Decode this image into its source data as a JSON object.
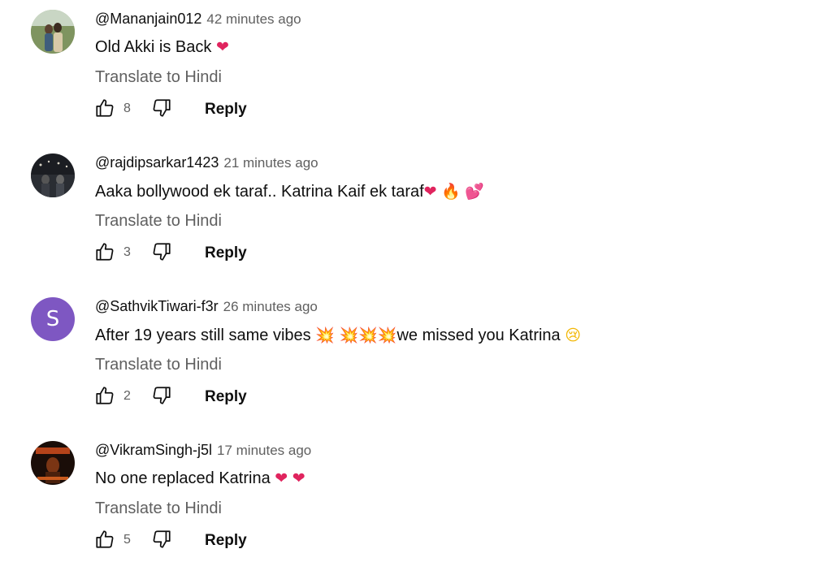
{
  "comments": [
    {
      "author": "@Mananjain012",
      "time": "42 minutes ago",
      "text": "Old Akki is Back",
      "emojis": [
        "❤"
      ],
      "translate": "Translate to Hindi",
      "likes": "8",
      "reply": "Reply",
      "avatar": "photo-two-people-outdoors"
    },
    {
      "author": "@rajdipsarkar1423",
      "time": "21 minutes ago",
      "text": "Aaka bollywood ek taraf.. Katrina Kaif ek taraf",
      "emojis": [
        "❤",
        "🔥",
        "💕"
      ],
      "translate": "Translate to Hindi",
      "likes": "3",
      "reply": "Reply",
      "avatar": "photo-dark-crowd-lights"
    },
    {
      "author": "@SathvikTiwari-f3r",
      "time": "26 minutes ago",
      "text_before": "After 19 years still same vibes",
      "text_after": "we missed you Katrina",
      "emojis_mid": [
        "💥",
        "💥",
        "💥",
        "💥"
      ],
      "emojis_end": [
        "😢"
      ],
      "translate": "Translate to Hindi",
      "likes": "2",
      "reply": "Reply",
      "avatar_letter": "S",
      "avatar_color": "#7e57c2"
    },
    {
      "author": "@VikramSingh-j5l",
      "time": "17 minutes ago",
      "text": "No one replaced Katrina",
      "emojis": [
        "❤",
        "❤"
      ],
      "translate": "Translate to Hindi",
      "likes": "5",
      "reply": "Reply",
      "avatar": "photo-dark-poster-orange"
    }
  ],
  "icons": {
    "like": "thumbs-up-icon",
    "dislike": "thumbs-down-icon"
  },
  "colors": {
    "primary_text": "#0f0f0f",
    "secondary_text": "#606060",
    "avatar_purple": "#7e57c2",
    "heart": "#e0245e"
  }
}
